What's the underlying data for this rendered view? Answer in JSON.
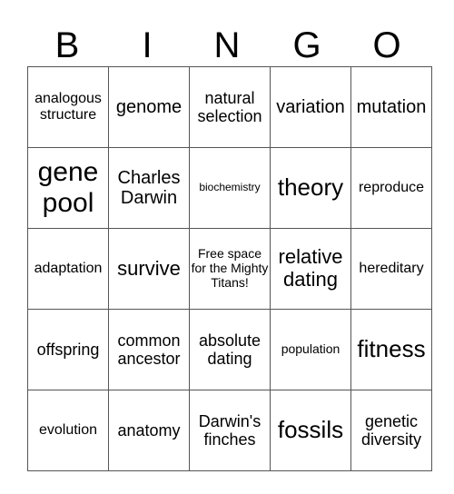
{
  "header": [
    "B",
    "I",
    "N",
    "G",
    "O"
  ],
  "rows": [
    [
      "analogous structure",
      "genome",
      "natural selection",
      "variation",
      "mutation"
    ],
    [
      "gene pool",
      "Charles Darwin",
      "biochemistry",
      "theory",
      "reproduce"
    ],
    [
      "adaptation",
      "survive",
      "Free space for the Mighty Titans!",
      "relative dating",
      "hereditary"
    ],
    [
      "offspring",
      "common ancestor",
      "absolute dating",
      "population",
      "fitness"
    ],
    [
      "evolution",
      "anatomy",
      "Darwin's finches",
      "fossils",
      "genetic diversity"
    ]
  ]
}
